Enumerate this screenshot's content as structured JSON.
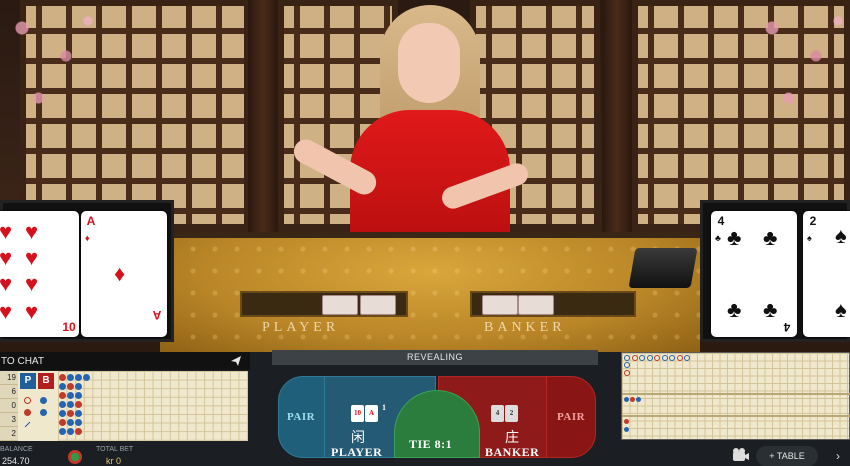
{
  "table": {
    "player_label": "PLAYER",
    "banker_label": "BANKER"
  },
  "player_cards": [
    {
      "rank": "10",
      "suit": "hearts",
      "color": "#d4121e"
    },
    {
      "rank": "A",
      "suit": "diamonds",
      "color": "#d4121e"
    }
  ],
  "banker_cards": [
    {
      "rank": "4",
      "suit": "clubs",
      "color": "#111111"
    },
    {
      "rank": "2",
      "suit": "spades",
      "color": "#111111"
    }
  ],
  "chat": {
    "header": "TO CHAT",
    "send_icon": "send-icon"
  },
  "stats": {
    "values": [
      "19",
      "6",
      "0",
      "3",
      "2"
    ],
    "p_label": "P",
    "b_label": "B"
  },
  "status": {
    "revealing": "REVEALING"
  },
  "bets": {
    "pair_left": "PAIR",
    "player_cn": "闲",
    "player": "PLAYER",
    "player_score": "1",
    "tie": "TIE 8:1",
    "banker_cn": "庄",
    "banker": "BANKER",
    "pair_right": "PAIR"
  },
  "wallet": {
    "balance_label": "BALANCE",
    "balance_value": "254.70",
    "total_bet_label": "TOTAL BET",
    "total_bet_value": "kr 0"
  },
  "controls": {
    "table_button": "+ TABLE",
    "more_button": "›"
  },
  "colors": {
    "player_blue": "#245a73",
    "banker_red": "#8f1a1a",
    "tie_green": "#2b7d3d"
  }
}
